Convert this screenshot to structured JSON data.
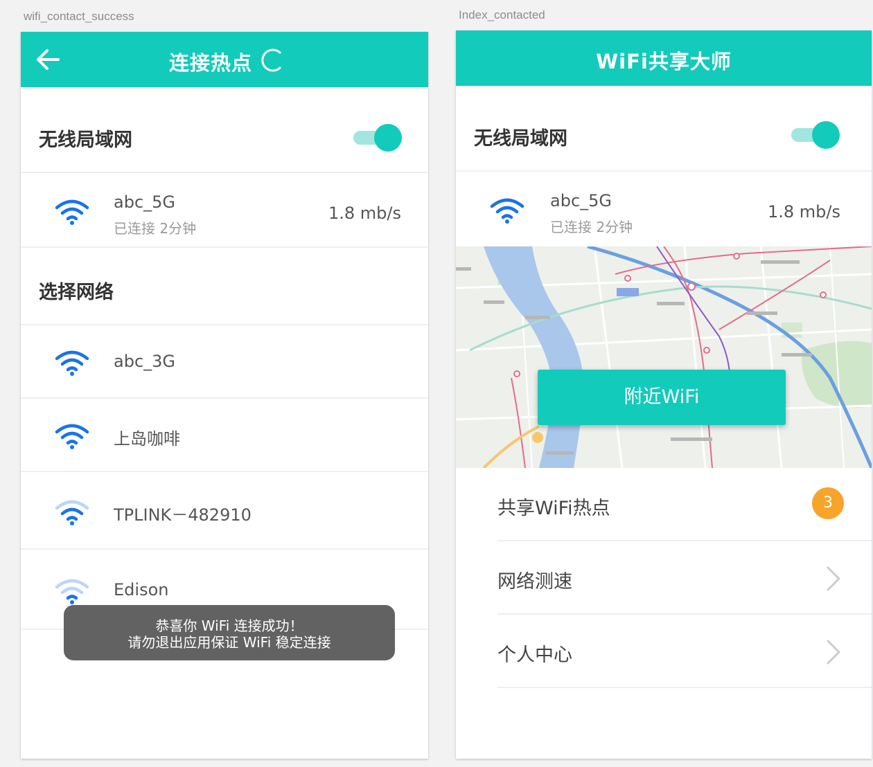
{
  "left_screen": {
    "artboard_label": "wifi_contact_success",
    "title": "连接热点",
    "wlan_label": "无线局域网",
    "connected": {
      "name": "abc_5G",
      "status": "已连接 2分钟",
      "speed": "1.8 mb/s"
    },
    "choose_label": "选择网络",
    "networks": [
      {
        "name": "abc_3G",
        "signal": "strong"
      },
      {
        "name": "上岛咖啡",
        "signal": "strong"
      },
      {
        "name": "TPLINK－482910",
        "signal": "medium"
      },
      {
        "name": "Edison",
        "signal": "weak"
      }
    ],
    "toast_line1": "恭喜你 WiFi 连接成功！",
    "toast_line2": "请勿退出应用保证 WiFi 稳定连接"
  },
  "right_screen": {
    "artboard_label": "Index_contacted",
    "title": "WiFi共享大师",
    "wlan_label": "无线局域网",
    "connected": {
      "name": "abc_5G",
      "status": "已连接 2分钟",
      "speed": "1.8 mb/s"
    },
    "nearby_button": "附近WiFi",
    "menu": [
      {
        "label": "共享WiFi热点",
        "badge": "3"
      },
      {
        "label": "网络测速"
      },
      {
        "label": "个人中心"
      }
    ]
  },
  "colors": {
    "accent": "#12cbbb",
    "wifi_blue": "#1a73e8",
    "badge": "#f7a42a"
  },
  "icons": [
    "back-arrow-icon",
    "loading-spinner-icon",
    "wifi-icon",
    "chevron-right-icon"
  ]
}
